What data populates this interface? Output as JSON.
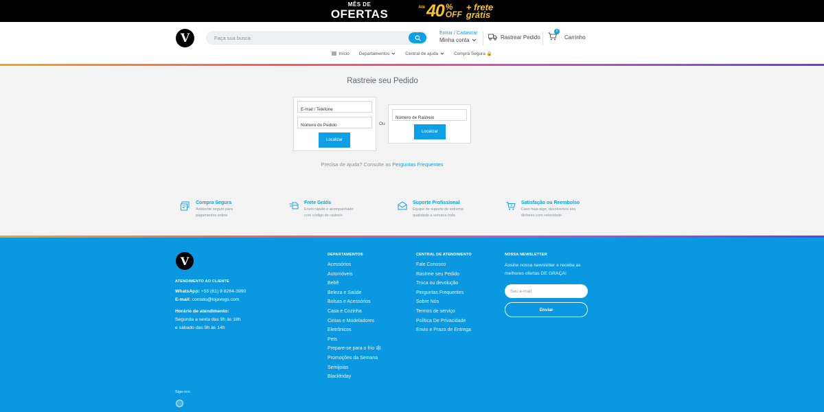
{
  "promo": {
    "small": "MÊS DE",
    "big": "OFERTAS",
    "ate": "Até",
    "discount": "40",
    "pct": "%",
    "off": "OFF",
    "frete1": "+ frete",
    "frete2": "grátis"
  },
  "header": {
    "logo_letter": "V",
    "search_placeholder": "Faça sua busca",
    "account_top": "Entrar / Cadastrar",
    "account_main": "Minha conta",
    "track_label": "Rastrear Pedido",
    "cart_label": "Carrinho",
    "cart_count": "0"
  },
  "nav": {
    "inicio": "Início",
    "departamentos": "Departamentos",
    "central": "Central de ajuda",
    "compra": "Compra Segura 🔒"
  },
  "main": {
    "title": "Rastreie seu Pedido",
    "email_placeholder": "E-mail / Telefone",
    "order_placeholder": "Número do Pedido",
    "tracking_placeholder": "Número de Rastreio",
    "locate_label": "Localizar",
    "or_label": "Ou",
    "help_prefix": "Precisa de ajuda? Consulte as",
    "help_link": "Perguntas Frequentes"
  },
  "features": [
    {
      "title": "Compra Segura",
      "desc": "Ambiente seguro para pagamentos online"
    },
    {
      "title": "Frete Grátis",
      "desc": "Envio rápido e acompanhado com código de rastreio"
    },
    {
      "title": "Suporte Profissional",
      "desc": "Equipe de suporte de extrema qualidade a semana toda"
    },
    {
      "title": "Satisfação ou Reembolso",
      "desc": "Caso haja algo, devolvemos seu dinheiro com velocidade"
    }
  ],
  "footer": {
    "logo_letter": "V",
    "service_heading": "ATENDIMENTO AO CLIENTE",
    "whatsapp_label": "WhatsApp:",
    "whatsapp_value": "+55 (61) 9 8264-3990",
    "email_label": "E-mail:",
    "email_value": "contato@lojavogs.com",
    "hours_label": "Horário de atendimento:",
    "hours_line1": "Segunda a sexta das 9h às 18h",
    "hours_line2": "e sábado das 9h às 14h",
    "follow_label": "Siga-nos",
    "departments_heading": "DEPARTAMENTOS",
    "departments": [
      "Acessórios",
      "Automóveis",
      "Bebê",
      "Beleza e Saúde",
      "Bolsas e Acessórios",
      "Casa e Cozinha",
      "Cintas e Modeladores",
      "Eletrônicos",
      "Pets",
      "Prepare-se para o frio ❄️",
      "Promoções da Semana",
      "Semijoias",
      "Blackfriday"
    ],
    "center_heading": "CENTRAL DE ATENDIMENTO",
    "center": [
      "Fale Conosco",
      "Rastreie seu Pedido",
      "Troca ou devolução",
      "Perguntas Frequentes",
      "Sobre Nós",
      "Termos de serviço",
      "Política De Privacidade",
      "Envio e Prazo de Entrega"
    ],
    "newsletter_heading": "NOSSA NEWSLETTER",
    "newsletter_text": "Assine nossa newsletter e receba as melhores ofertas DE GRAÇA!",
    "newsletter_placeholder": "Seu e-mail",
    "newsletter_button": "Enviar"
  },
  "colors": {
    "accent": "#0da0e6",
    "footer_bg": "#0a98e0",
    "promo_yellow": "#f6c324"
  }
}
